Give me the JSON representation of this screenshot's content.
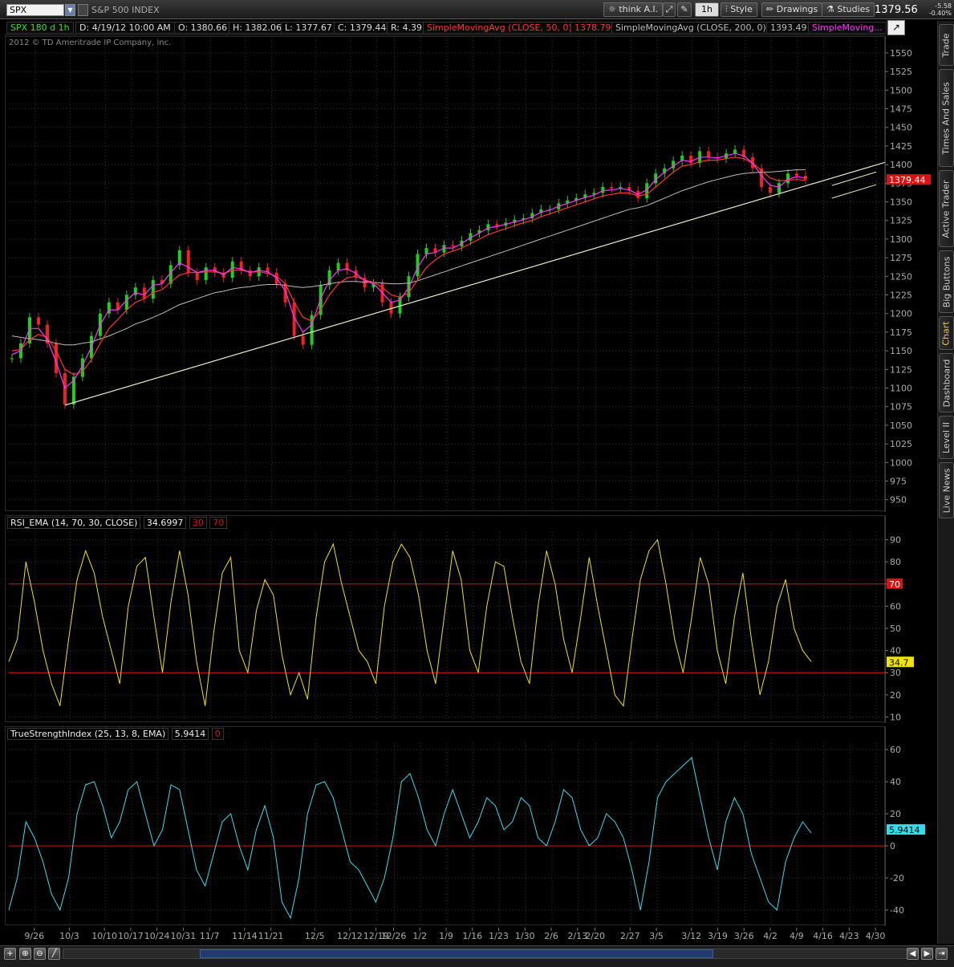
{
  "toolbar": {
    "symbol": "SPX",
    "symbol_name": "S&P 500 INDEX",
    "think_ai": "think A.I.",
    "interval": "1h",
    "style": "Style",
    "drawings": "Drawings",
    "studies": "Studies",
    "last_price": "1379.56",
    "change": "-5.58",
    "change_pct": "-0.40%"
  },
  "infobar": {
    "period": "SPX 180 d 1h",
    "date": "D: 4/19/12 10:00 AM",
    "open": "O: 1380.66",
    "high": "H: 1382.06",
    "low": "L: 1377.67",
    "close": "C: 1379.44",
    "range": "R: 4.39",
    "sma50_label": "SimpleMovingAvg (CLOSE, 50, 0)",
    "sma50_value": "1378.79",
    "sma200_label": "SimpleMovingAvg (CLOSE, 200, 0)",
    "sma200_value": "1393.49",
    "sma_third_label": "SimpleMoving...",
    "copyright": "2012 © TD Ameritrade IP Company, Inc."
  },
  "colors": {
    "price_up": "#22cc22",
    "price_down": "#ee2222",
    "sma_fast": "#ff33ff",
    "sma50": "#ff3333",
    "sma200": "#bbbbbb",
    "trendline": "#e6f0c0",
    "rsi": "#f0e400",
    "tsi": "#33ddee",
    "levels": "#dd1111"
  },
  "sidebar_tabs": [
    "Trade",
    "Times And Sales",
    "Active Trader",
    "Big Buttons",
    "Chart",
    "Dashboard",
    "Level II",
    "Live News"
  ],
  "chart_data": [
    {
      "id": "price",
      "type": "line",
      "ylim": [
        940,
        1565
      ],
      "yticks": [
        950,
        975,
        1000,
        1025,
        1050,
        1075,
        1100,
        1125,
        1150,
        1175,
        1200,
        1225,
        1250,
        1275,
        1300,
        1325,
        1350,
        1375,
        1400,
        1425,
        1450,
        1475,
        1500,
        1525,
        1550
      ],
      "current_price_label": "1379.44",
      "series": [
        {
          "key": "price",
          "values": [
            1140,
            1160,
            1195,
            1185,
            1160,
            1120,
            1078,
            1115,
            1140,
            1170,
            1200,
            1215,
            1205,
            1225,
            1235,
            1220,
            1245,
            1240,
            1265,
            1285,
            1255,
            1245,
            1262,
            1255,
            1248,
            1270,
            1258,
            1250,
            1262,
            1255,
            1240,
            1215,
            1170,
            1158,
            1198,
            1238,
            1258,
            1268,
            1258,
            1248,
            1235,
            1240,
            1215,
            1200,
            1222,
            1250,
            1280,
            1288,
            1282,
            1292,
            1290,
            1298,
            1308,
            1312,
            1320,
            1318,
            1322,
            1326,
            1328,
            1335,
            1340,
            1340,
            1348,
            1352,
            1355,
            1360,
            1362,
            1370,
            1368,
            1370,
            1365,
            1355,
            1375,
            1388,
            1395,
            1405,
            1412,
            1402,
            1418,
            1410,
            1408,
            1415,
            1420,
            1410,
            1395,
            1370,
            1362,
            1375,
            1388,
            1385,
            1380
          ]
        },
        {
          "key": "sma_fast",
          "values": [
            1145,
            1150,
            1180,
            1180,
            1165,
            1135,
            1100,
            1110,
            1130,
            1155,
            1185,
            1205,
            1205,
            1218,
            1228,
            1225,
            1238,
            1240,
            1255,
            1268,
            1262,
            1255,
            1258,
            1258,
            1252,
            1262,
            1260,
            1255,
            1258,
            1256,
            1248,
            1230,
            1195,
            1175,
            1185,
            1220,
            1245,
            1258,
            1260,
            1254,
            1244,
            1240,
            1228,
            1215,
            1218,
            1235,
            1262,
            1280,
            1282,
            1288,
            1288,
            1294,
            1302,
            1308,
            1315,
            1317,
            1320,
            1323,
            1326,
            1330,
            1336,
            1339,
            1344,
            1348,
            1352,
            1356,
            1359,
            1365,
            1366,
            1368,
            1366,
            1360,
            1366,
            1380,
            1390,
            1398,
            1406,
            1404,
            1410,
            1410,
            1409,
            1412,
            1415,
            1412,
            1402,
            1385,
            1372,
            1370,
            1380,
            1384,
            1382
          ]
        },
        {
          "key": "sma50",
          "values": [
            1150,
            1152,
            1165,
            1172,
            1168,
            1150,
            1125,
            1118,
            1122,
            1138,
            1160,
            1180,
            1192,
            1205,
            1215,
            1220,
            1228,
            1232,
            1242,
            1252,
            1255,
            1255,
            1256,
            1256,
            1254,
            1258,
            1258,
            1256,
            1256,
            1254,
            1250,
            1240,
            1215,
            1195,
            1190,
            1205,
            1225,
            1240,
            1248,
            1250,
            1245,
            1242,
            1235,
            1225,
            1222,
            1228,
            1245,
            1262,
            1272,
            1280,
            1284,
            1288,
            1294,
            1300,
            1306,
            1310,
            1314,
            1318,
            1322,
            1325,
            1330,
            1334,
            1338,
            1342,
            1346,
            1350,
            1354,
            1358,
            1360,
            1362,
            1362,
            1358,
            1360,
            1370,
            1380,
            1390,
            1398,
            1400,
            1404,
            1406,
            1406,
            1408,
            1410,
            1408,
            1402,
            1392,
            1382,
            1378,
            1379,
            1380,
            1379
          ]
        },
        {
          "key": "sma200",
          "values": [
            1170,
            1168,
            1166,
            1165,
            1163,
            1160,
            1158,
            1158,
            1160,
            1162,
            1166,
            1170,
            1175,
            1180,
            1186,
            1190,
            1195,
            1200,
            1206,
            1212,
            1216,
            1220,
            1224,
            1228,
            1230,
            1233,
            1235,
            1236,
            1238,
            1239,
            1239,
            1238,
            1236,
            1235,
            1236,
            1238,
            1240,
            1242,
            1243,
            1243,
            1242,
            1242,
            1241,
            1240,
            1240,
            1241,
            1244,
            1248,
            1252,
            1256,
            1260,
            1264,
            1268,
            1272,
            1276,
            1280,
            1284,
            1288,
            1292,
            1296,
            1300,
            1304,
            1308,
            1312,
            1316,
            1320,
            1324,
            1328,
            1332,
            1336,
            1340,
            1342,
            1345,
            1350,
            1355,
            1360,
            1365,
            1369,
            1373,
            1377,
            1380,
            1383,
            1386,
            1388,
            1389,
            1390,
            1390,
            1391,
            1392,
            1393,
            1393
          ]
        }
      ],
      "trendline": {
        "from": [
          6,
          1077
        ],
        "to": [
          99,
          1403
        ]
      },
      "channel_lower": {
        "from": [
          93,
          1355
        ],
        "to": [
          98,
          1373
        ]
      },
      "channel_upper": {
        "from": [
          93,
          1372
        ],
        "to": [
          98,
          1390
        ]
      }
    },
    {
      "id": "rsi",
      "type": "line",
      "title": "RSI_EMA (14, 70, 30, CLOSE)",
      "title_value": "34.6997",
      "level_labels": [
        "30",
        "70"
      ],
      "ylim": [
        8,
        92
      ],
      "yticks": [
        10,
        20,
        30,
        40,
        50,
        60,
        70,
        80,
        90
      ],
      "levels": [
        30,
        70
      ],
      "current_label": "34.7",
      "values": [
        35,
        45,
        80,
        62,
        40,
        25,
        15,
        45,
        72,
        85,
        75,
        55,
        40,
        25,
        60,
        78,
        82,
        55,
        30,
        62,
        85,
        65,
        35,
        15,
        48,
        75,
        82,
        40,
        30,
        58,
        72,
        65,
        38,
        20,
        30,
        18,
        55,
        80,
        88,
        70,
        55,
        40,
        35,
        25,
        60,
        80,
        88,
        82,
        65,
        40,
        25,
        55,
        85,
        72,
        40,
        30,
        60,
        80,
        78,
        55,
        35,
        25,
        60,
        85,
        70,
        45,
        30,
        55,
        82,
        60,
        40,
        20,
        15,
        45,
        72,
        85,
        90,
        70,
        45,
        30,
        55,
        82,
        70,
        40,
        25,
        55,
        75,
        45,
        20,
        35,
        60,
        72,
        50,
        40,
        35
      ]
    },
    {
      "id": "tsi",
      "type": "line",
      "title": "TrueStrengthIndex (25, 13, 8, EMA)",
      "title_value": "5.9414",
      "level_labels": [
        "0"
      ],
      "ylim": [
        -48,
        62
      ],
      "yticks": [
        -40,
        -20,
        0,
        20,
        40,
        60
      ],
      "levels": [
        0
      ],
      "current_label": "5.9414",
      "values": [
        -40,
        -20,
        15,
        5,
        -10,
        -30,
        -40,
        -20,
        20,
        38,
        40,
        25,
        5,
        15,
        35,
        40,
        20,
        0,
        10,
        38,
        35,
        10,
        -15,
        -25,
        -5,
        15,
        20,
        0,
        -15,
        10,
        25,
        5,
        -35,
        -45,
        -20,
        20,
        38,
        40,
        30,
        10,
        -10,
        -15,
        -25,
        -35,
        -20,
        5,
        40,
        45,
        30,
        10,
        0,
        20,
        35,
        20,
        5,
        15,
        30,
        25,
        10,
        15,
        30,
        25,
        5,
        0,
        15,
        35,
        30,
        10,
        0,
        5,
        20,
        15,
        5,
        -15,
        -40,
        -10,
        30,
        40,
        45,
        50,
        55,
        30,
        5,
        -15,
        15,
        30,
        20,
        -5,
        -20,
        -35,
        -40,
        -10,
        5,
        15,
        8
      ]
    },
    {
      "id": "x-axis",
      "type": "line",
      "xticks": [
        {
          "i": 3,
          "label": "9/26"
        },
        {
          "i": 7,
          "label": "10/3"
        },
        {
          "i": 11,
          "label": "10/10"
        },
        {
          "i": 14,
          "label": "10/17"
        },
        {
          "i": 17,
          "label": "10/24"
        },
        {
          "i": 20,
          "label": "10/31"
        },
        {
          "i": 23,
          "label": "11/7"
        },
        {
          "i": 27,
          "label": "11/14"
        },
        {
          "i": 30,
          "label": "11/21"
        },
        {
          "i": 35,
          "label": "12/5"
        },
        {
          "i": 39,
          "label": "12/12"
        },
        {
          "i": 42,
          "label": "12/19"
        },
        {
          "i": 44,
          "label": "12/26"
        },
        {
          "i": 47,
          "label": "1/2"
        },
        {
          "i": 50,
          "label": "1/9"
        },
        {
          "i": 53,
          "label": "1/16"
        },
        {
          "i": 56,
          "label": "1/23"
        },
        {
          "i": 59,
          "label": "1/30"
        },
        {
          "i": 62,
          "label": "2/6"
        },
        {
          "i": 65,
          "label": "2/13"
        },
        {
          "i": 67,
          "label": "2/20"
        },
        {
          "i": 71,
          "label": "2/27"
        },
        {
          "i": 74,
          "label": "3/5"
        },
        {
          "i": 78,
          "label": "3/12"
        },
        {
          "i": 81,
          "label": "3/19"
        },
        {
          "i": 84,
          "label": "3/26"
        },
        {
          "i": 87,
          "label": "4/2"
        },
        {
          "i": 90,
          "label": "4/9"
        },
        {
          "i": 93,
          "label": "4/16"
        },
        {
          "i": 96,
          "label": "4/23"
        },
        {
          "i": 99,
          "label": "4/30"
        }
      ]
    }
  ]
}
